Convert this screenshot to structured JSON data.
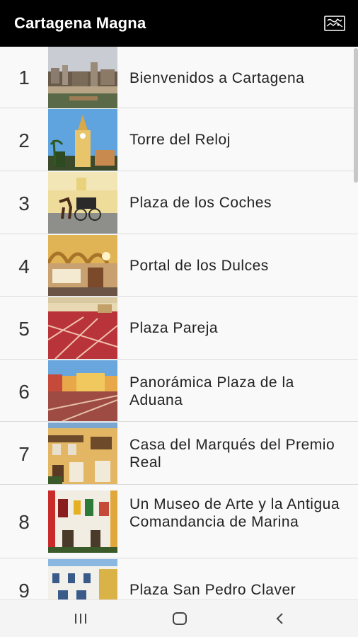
{
  "app": {
    "title": "Cartagena Magna",
    "action_icon": "map-icon"
  },
  "items": [
    {
      "number": "1",
      "title": "Bienvenidos a Cartagena",
      "thumbnail": "city-panorama"
    },
    {
      "number": "2",
      "title": "Torre del Reloj",
      "thumbnail": "clock-tower"
    },
    {
      "number": "3",
      "title": "Plaza de los Coches",
      "thumbnail": "horse-carriage"
    },
    {
      "number": "4",
      "title": "Portal de los Dulces",
      "thumbnail": "sweets-portal"
    },
    {
      "number": "5",
      "title": "Plaza Pareja",
      "thumbnail": "plaza-pavement"
    },
    {
      "number": "6",
      "title": "Panorámica Plaza de la Aduana",
      "thumbnail": "aduana-square"
    },
    {
      "number": "7",
      "title": "Casa del Marqués del Premio Real",
      "thumbnail": "colonial-house"
    },
    {
      "number": "8",
      "title": "Un Museo de Arte y la Antigua Comandancia de Marina",
      "thumbnail": "colorful-facade"
    },
    {
      "number": "9",
      "title": "Plaza San Pedro Claver",
      "thumbnail": "white-building"
    }
  ],
  "navigation": {
    "recents_icon": "recents-icon",
    "home_icon": "home-icon",
    "back_icon": "back-icon"
  }
}
